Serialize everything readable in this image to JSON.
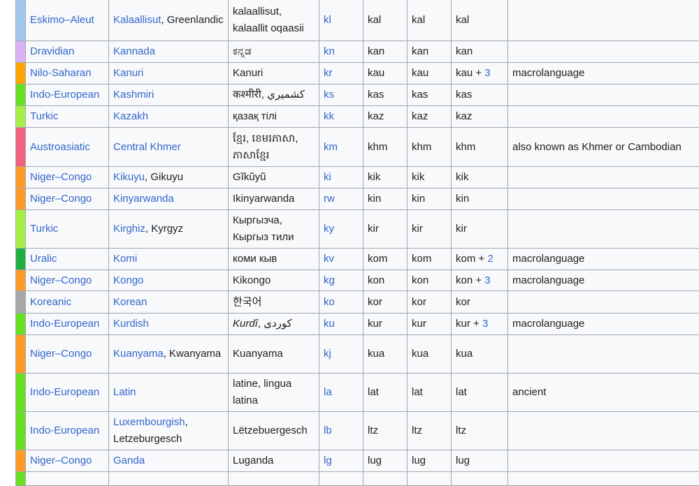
{
  "colors": {
    "link": "#3366cc",
    "text": "#202122",
    "border": "#a2a9b1",
    "cell_bg": "#f8f9fa"
  },
  "rows": [
    {
      "color": "#a2c8f0",
      "family": "Eskimo–Aleut",
      "name_parts": [
        {
          "text": "Kalaallisut",
          "link": true
        },
        {
          "text": ", Greenlandic",
          "link": false
        }
      ],
      "native": [
        {
          "text": "kalaallisut, kalaallit oqaasii"
        }
      ],
      "c1": "kl",
      "c2": "kal",
      "c3": "kal",
      "c4": "kal",
      "c4_suffix": "",
      "c4_count": "",
      "notes": "",
      "h": 60
    },
    {
      "color": "#dcb0f5",
      "family": "Dravidian",
      "name_parts": [
        {
          "text": "Kannada",
          "link": true
        }
      ],
      "native": [
        {
          "text": "ಕನ್ನಡ"
        }
      ],
      "c1": "kn",
      "c2": "kan",
      "c3": "kan",
      "c4": "kan",
      "c4_suffix": "",
      "c4_count": "",
      "notes": "",
      "h": 31
    },
    {
      "color": "#ffa500",
      "family": "Nilo-Saharan",
      "name_parts": [
        {
          "text": "Kanuri",
          "link": true
        }
      ],
      "native": [
        {
          "text": "Kanuri"
        }
      ],
      "c1": "kr",
      "c2": "kau",
      "c3": "kau",
      "c4": "kau",
      "c4_suffix": " + ",
      "c4_count": "3",
      "notes": "macrolanguage",
      "h": 31
    },
    {
      "color": "#66e020",
      "family": "Indo-European",
      "name_parts": [
        {
          "text": "Kashmiri",
          "link": true
        }
      ],
      "native": [
        {
          "text": "कश्मीरी, كشميري‎"
        }
      ],
      "c1": "ks",
      "c2": "kas",
      "c3": "kas",
      "c4": "kas",
      "c4_suffix": "",
      "c4_count": "",
      "notes": "",
      "h": 31
    },
    {
      "color": "#a6ef46",
      "family": "Turkic",
      "name_parts": [
        {
          "text": "Kazakh",
          "link": true
        }
      ],
      "native": [
        {
          "text": "қазақ тілі"
        }
      ],
      "c1": "kk",
      "c2": "kaz",
      "c3": "kaz",
      "c4": "kaz",
      "c4_suffix": "",
      "c4_count": "",
      "notes": "",
      "h": 31
    },
    {
      "color": "#f46080",
      "family": "Austroasiatic",
      "name_parts": [
        {
          "text": "Central Khmer",
          "link": true
        }
      ],
      "native": [
        {
          "text": "ខ្មែរ, ខេមរភាសា, ភាសាខ្មែរ"
        }
      ],
      "c1": "km",
      "c2": "khm",
      "c3": "khm",
      "c4": "khm",
      "c4_suffix": "",
      "c4_count": "",
      "notes": "also known as Khmer or Cambodian",
      "h": 56
    },
    {
      "color": "#ff9a26",
      "family": "Niger–Congo",
      "name_parts": [
        {
          "text": "Kikuyu",
          "link": true
        },
        {
          "text": ", Gikuyu",
          "link": false
        }
      ],
      "native": [
        {
          "text": "Gĩkũyũ"
        }
      ],
      "c1": "ki",
      "c2": "kik",
      "c3": "kik",
      "c4": "kik",
      "c4_suffix": "",
      "c4_count": "",
      "notes": "",
      "h": 31
    },
    {
      "color": "#ff9a26",
      "family": "Niger–Congo",
      "name_parts": [
        {
          "text": "Kinyarwanda",
          "link": true
        }
      ],
      "native": [
        {
          "text": "Ikinyarwanda"
        }
      ],
      "c1": "rw",
      "c2": "kin",
      "c3": "kin",
      "c4": "kin",
      "c4_suffix": "",
      "c4_count": "",
      "notes": "",
      "h": 31
    },
    {
      "color": "#a6ef46",
      "family": "Turkic",
      "name_parts": [
        {
          "text": "Kirghiz",
          "link": true
        },
        {
          "text": ", Kyrgyz",
          "link": false
        }
      ],
      "native": [
        {
          "text": "Кыргызча, Кыргыз тили"
        }
      ],
      "c1": "ky",
      "c2": "kir",
      "c3": "kir",
      "c4": "kir",
      "c4_suffix": "",
      "c4_count": "",
      "notes": "",
      "h": 55
    },
    {
      "color": "#20b040",
      "family": "Uralic",
      "name_parts": [
        {
          "text": "Komi",
          "link": true
        }
      ],
      "native": [
        {
          "text": "коми кыв"
        }
      ],
      "c1": "kv",
      "c2": "kom",
      "c3": "kom",
      "c4": "kom",
      "c4_suffix": " + ",
      "c4_count": "2",
      "notes": "macrolanguage",
      "h": 31
    },
    {
      "color": "#ff9a26",
      "family": "Niger–Congo",
      "name_parts": [
        {
          "text": "Kongo",
          "link": true
        }
      ],
      "native": [
        {
          "text": "Kikongo"
        }
      ],
      "c1": "kg",
      "c2": "kon",
      "c3": "kon",
      "c4": "kon",
      "c4_suffix": " + ",
      "c4_count": "3",
      "notes": "macrolanguage",
      "h": 30
    },
    {
      "color": "#a8a8a8",
      "family": "Koreanic",
      "name_parts": [
        {
          "text": "Korean",
          "link": true
        }
      ],
      "native": [
        {
          "text": "한국어"
        }
      ],
      "c1": "ko",
      "c2": "kor",
      "c3": "kor",
      "c4": "kor",
      "c4_suffix": "",
      "c4_count": "",
      "notes": "",
      "h": 32
    },
    {
      "color": "#66e020",
      "family": "Indo-European",
      "name_parts": [
        {
          "text": "Kurdish",
          "link": true
        }
      ],
      "native": [
        {
          "text": "Kurdî",
          "italic": true
        },
        {
          "text": ", كوردی‎"
        }
      ],
      "c1": "ku",
      "c2": "kur",
      "c3": "kur",
      "c4": "kur",
      "c4_suffix": " + ",
      "c4_count": "3",
      "notes": "macrolanguage",
      "h": 31
    },
    {
      "color": "#ff9a26",
      "family": "Niger–Congo",
      "name_parts": [
        {
          "text": "Kuanyama",
          "link": true
        },
        {
          "text": ", Kwanyama",
          "link": false
        }
      ],
      "native": [
        {
          "text": "Kuanyama"
        }
      ],
      "c1": "kj",
      "c2": "kua",
      "c3": "kua",
      "c4": "kua",
      "c4_suffix": "",
      "c4_count": "",
      "notes": "",
      "h": 55
    },
    {
      "color": "#66e020",
      "family": "Indo-European",
      "name_parts": [
        {
          "text": "Latin",
          "link": true
        }
      ],
      "native": [
        {
          "text": "latine, lingua latina"
        }
      ],
      "c1": "la",
      "c2": "lat",
      "c3": "lat",
      "c4": "lat",
      "c4_suffix": "",
      "c4_count": "",
      "notes": "ancient",
      "h": 55
    },
    {
      "color": "#66e020",
      "family": "Indo-European",
      "name_parts": [
        {
          "text": "Luxembourgish",
          "link": true
        },
        {
          "text": ", Letzeburgesch",
          "link": false
        }
      ],
      "native": [
        {
          "text": "Lëtzebuergesch"
        }
      ],
      "c1": "lb",
      "c2": "ltz",
      "c3": "ltz",
      "c4": "ltz",
      "c4_suffix": "",
      "c4_count": "",
      "notes": "",
      "h": 55
    },
    {
      "color": "#ff9a26",
      "family": "Niger–Congo",
      "name_parts": [
        {
          "text": "Ganda",
          "link": true
        }
      ],
      "native": [
        {
          "text": "Luganda"
        }
      ],
      "c1": "lg",
      "c2": "lug",
      "c3": "lug",
      "c4": "lug",
      "c4_suffix": "",
      "c4_count": "",
      "notes": "",
      "h": 31
    },
    {
      "color": "#66e020",
      "family": "",
      "name_parts": [],
      "native": [],
      "c1": "",
      "c2": "",
      "c3": "",
      "c4": "",
      "c4_suffix": "",
      "c4_count": "",
      "notes": "",
      "h": 20
    }
  ]
}
